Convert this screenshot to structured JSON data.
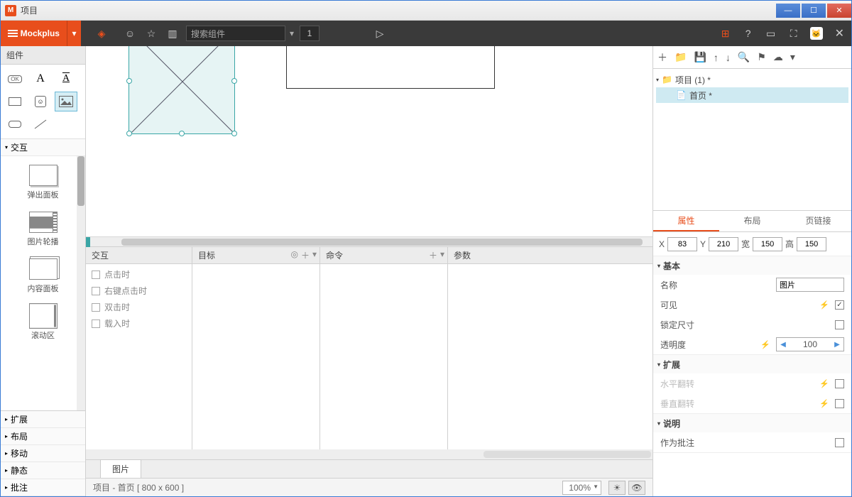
{
  "titlebar": {
    "title": "项目"
  },
  "toolbar": {
    "brand": "Mockplus",
    "search_placeholder": "搜索组件",
    "page_num": "1"
  },
  "left": {
    "title": "组件",
    "section_interact": "交互",
    "widgets": [
      {
        "label": "弹出面板"
      },
      {
        "label": "图片轮播"
      },
      {
        "label": "内容面板"
      },
      {
        "label": "滚动区"
      }
    ],
    "accordion": [
      "扩展",
      "布局",
      "移动",
      "静态",
      "批注"
    ]
  },
  "interaction": {
    "cols": {
      "c1": "交互",
      "c2": "目标",
      "c3": "命令",
      "c4": "参数"
    },
    "events": [
      "点击时",
      "右键点击时",
      "双击时",
      "载入时"
    ],
    "tab": "图片"
  },
  "statusbar": {
    "path": "项目 - 首页 [ 800 x 600 ]",
    "zoom": "100%"
  },
  "tree": {
    "root": "项目 (1) *",
    "child": "首页 *"
  },
  "right": {
    "tabs": {
      "prop": "属性",
      "layout": "布局",
      "link": "页链接"
    },
    "x_lbl": "X",
    "x": "83",
    "y_lbl": "Y",
    "y": "210",
    "w_lbl": "宽",
    "w": "150",
    "h_lbl": "高",
    "h": "150",
    "basic": "基本",
    "name_lbl": "名称",
    "name_val": "图片",
    "visible_lbl": "可见",
    "lock_lbl": "锁定尺寸",
    "opacity_lbl": "透明度",
    "opacity_val": "100",
    "extend": "扩展",
    "fliph": "水平翻转",
    "flipv": "垂直翻转",
    "desc": "说明",
    "annot": "作为批注"
  }
}
